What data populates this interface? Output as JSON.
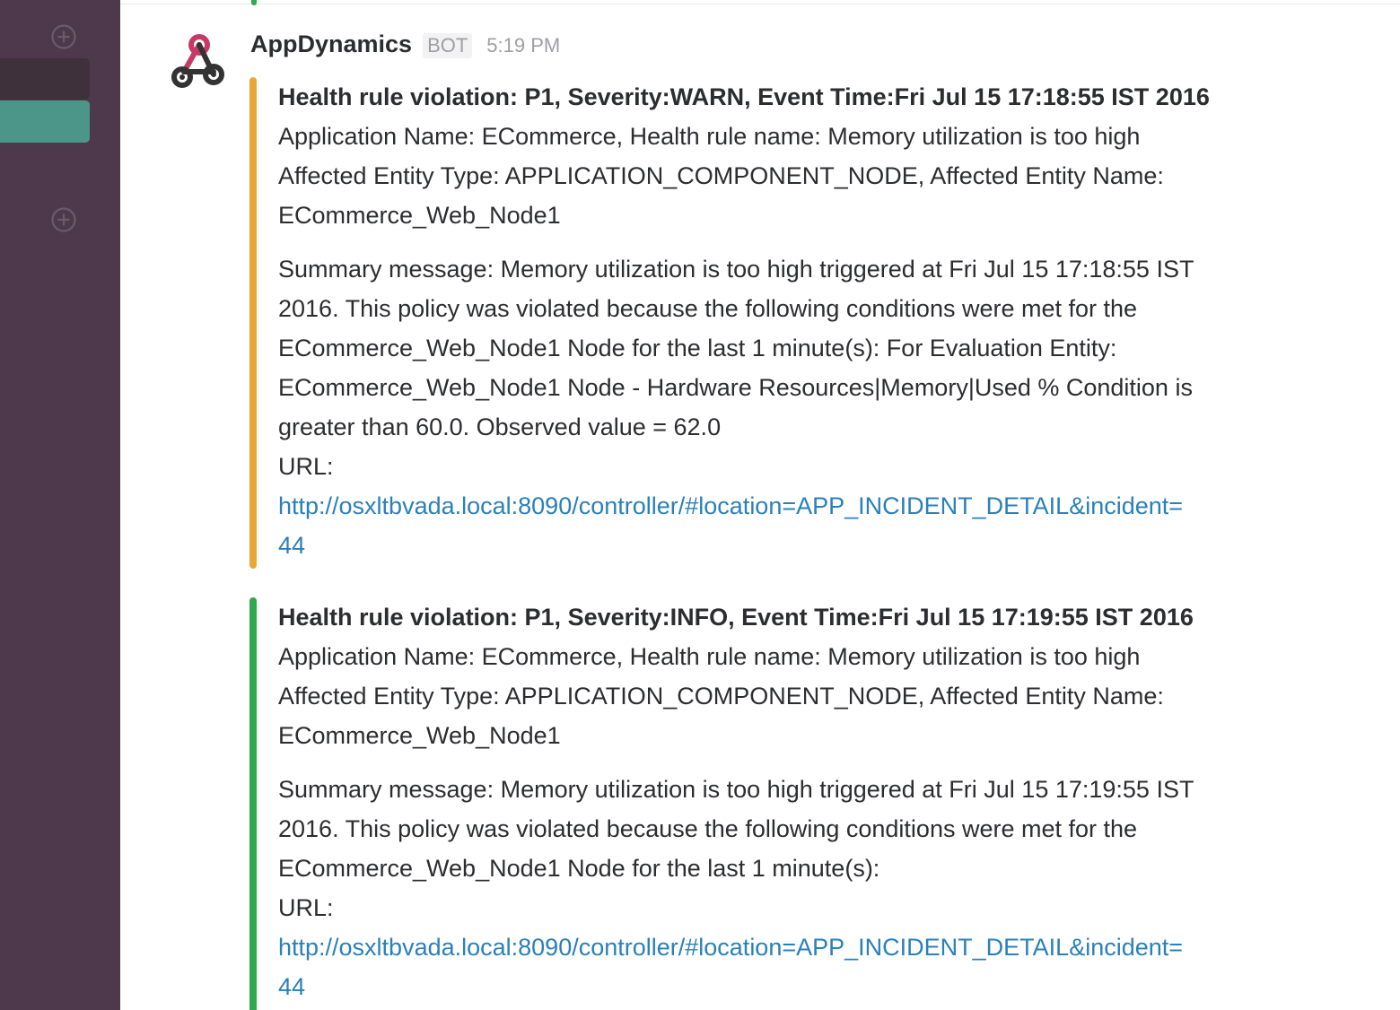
{
  "colors": {
    "sidebar_bg": "#4d394b",
    "sidebar_active": "#4c9689",
    "warn_bar": "#e8a838",
    "info_bar": "#2fa84f",
    "link": "#2a80b9"
  },
  "sidebar": {
    "icons": [
      "plus-circle-icon",
      "plus-circle-icon"
    ]
  },
  "message": {
    "avatar_icon": "webhook-icon",
    "sender": "AppDynamics",
    "badge": "BOT",
    "time": "5:19 PM",
    "attachments": [
      {
        "severity_color": "warn",
        "title": "Health rule violation: P1, Severity:WARN, Event Time:Fri Jul 15 17:18:55 IST 2016",
        "lines": [
          "Application Name: ECommerce, Health rule name: Memory utilization is too high",
          "Affected Entity Type: APPLICATION_COMPONENT_NODE, Affected Entity Name:",
          "ECommerce_Web_Node1"
        ],
        "summary_lines": [
          "Summary message: Memory utilization is too high triggered at Fri Jul 15 17:18:55 IST",
          "2016. This policy was violated because the following conditions were met for the",
          "ECommerce_Web_Node1 Node for the last 1 minute(s):   For Evaluation Entity:",
          "ECommerce_Web_Node1 Node - Hardware Resources|Memory|Used % Condition is",
          "greater than 60.0. Observed value = 62.0"
        ],
        "url_label": "URL:",
        "url_lines": [
          "http://osxltbvada.local:8090/controller/#location=APP_INCIDENT_DETAIL&incident=",
          "44"
        ]
      },
      {
        "severity_color": "info",
        "title": "Health rule violation: P1, Severity:INFO, Event Time:Fri Jul 15 17:19:55 IST 2016",
        "lines": [
          "Application Name: ECommerce, Health rule name: Memory utilization is too high",
          "Affected Entity Type: APPLICATION_COMPONENT_NODE, Affected Entity Name:",
          "ECommerce_Web_Node1"
        ],
        "summary_lines": [
          "Summary message: Memory utilization is too high triggered at Fri Jul 15 17:19:55 IST",
          "2016. This policy was violated because the following conditions were met for the",
          "ECommerce_Web_Node1 Node for the last 1 minute(s):"
        ],
        "url_label": "URL:",
        "url_lines": [
          "http://osxltbvada.local:8090/controller/#location=APP_INCIDENT_DETAIL&incident=",
          "44"
        ]
      }
    ]
  }
}
